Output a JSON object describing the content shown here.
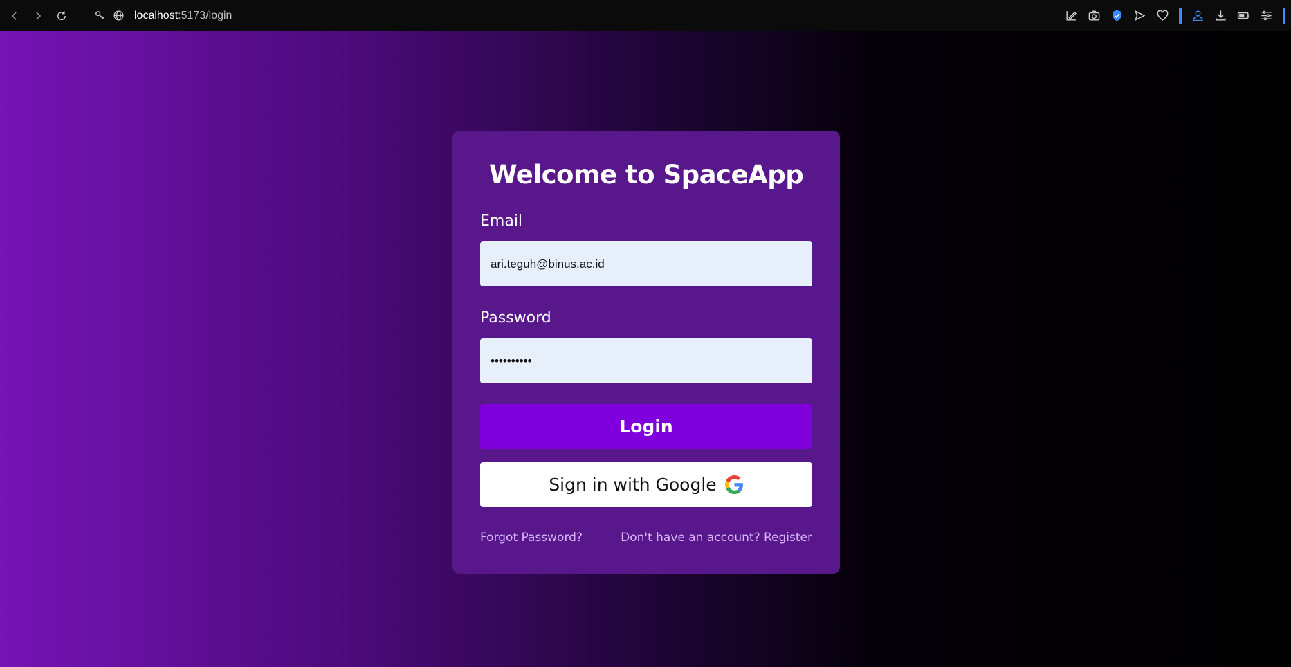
{
  "browser": {
    "url_host": "localhost",
    "url_path": ":5173/login"
  },
  "login": {
    "title": "Welcome to SpaceApp",
    "email_label": "Email",
    "email_value": "ari.teguh@binus.ac.id",
    "password_label": "Password",
    "password_value": "••••••••••",
    "login_button": "Login",
    "google_button": "Sign in with Google",
    "forgot_password": "Forgot Password?",
    "register_link": "Don't have an account? Register"
  },
  "colors": {
    "card_bg": "#58178a",
    "login_button": "#7f00dc",
    "input_bg": "#e7effb",
    "link_color": "#d9b8ff",
    "gradient_start": "#7614b6",
    "gradient_end": "#000000"
  },
  "icons": {
    "back": "back-arrow-icon",
    "forward": "forward-arrow-icon",
    "reload": "reload-icon",
    "site_info": "site-info-icon",
    "globe": "globe-icon",
    "google": "google-logo-icon"
  }
}
